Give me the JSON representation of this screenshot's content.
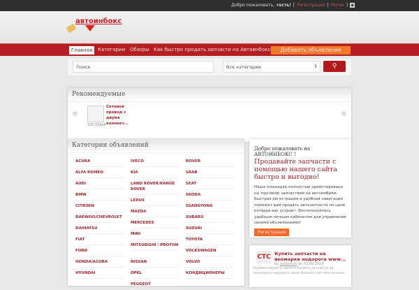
{
  "topbar": {
    "welcome": "Добро пожаловать,",
    "user": "гость!",
    "sep1": "[",
    "register": "Регистрация",
    "sep2": "|",
    "login": "Логин",
    "sep3": "]"
  },
  "logo": {
    "text": "автоинбокс"
  },
  "nav": {
    "items": [
      "Главная",
      "Категории",
      "Обзоры",
      "Как быстро продать запчасти на Автоинбоксе ?"
    ],
    "add": "Добавить объявление"
  },
  "search": {
    "placeholder": "Поиск",
    "category": "Все категории",
    "arrows": "⇕",
    "button": "⚲"
  },
  "featured": {
    "title": "Рекомендуемые",
    "item": {
      "title": "Сетевой провод с двумя коннект...",
      "price": "100.00руб"
    }
  },
  "categories": {
    "title": "Категории объявлений",
    "col1": [
      "ACURA",
      "ALFA ROMEO",
      "AUDI",
      "BMW",
      "CITROEN",
      "DAEWOO/CHEVROLET",
      "DAIHATSU",
      "FIAT",
      "FORD",
      "HONDA/ACURA",
      "HYUNDAI"
    ],
    "col2": [
      "IVECO",
      "KIA",
      "LAND ROVER/RANGE ROVER",
      "LEXUS",
      "MAZDA",
      "MERCEDES",
      "MINI",
      "MITSUBISHI / PROTON",
      "NISSAN",
      "OPEL",
      "PEUGEOT"
    ],
    "col3": [
      "ROVER",
      "SAAB",
      "SEAT",
      "SKODA",
      "SSANGYONG",
      "SUBARU",
      "SUZUKI",
      "TOYOTA",
      "VOLKSWAGEN",
      "VOLVO",
      "КОНДИЦИОНЕРЫ"
    ]
  },
  "welcome": {
    "title": "Добро пожаловать на АВТОИНБОКС !",
    "slogan": "Продавайте запчасти с помощью нашего сайта быстро и выгодно!",
    "text": "Наша площадка полностью ориентирована на торговлю запчастями на автомобили. Быстрая регистрация и удобная навигация поможет вам продать автозапчасти по цене которая вас устроит. Воспользуйтесь удобным личным кабинетом для управления своими объявлениями!",
    "button": "Регистрация"
  },
  "post": {
    "thumb": "СТС",
    "title": "Купить запчасти на иномарки недорого www...",
    "by": "by",
    "author": "avtoinbox",
    "date": "on 02.09.2014",
    "excerpt": "Комментарии к записи Купить запчасти на иномарки недорого www.otoauto.com отключены"
  }
}
